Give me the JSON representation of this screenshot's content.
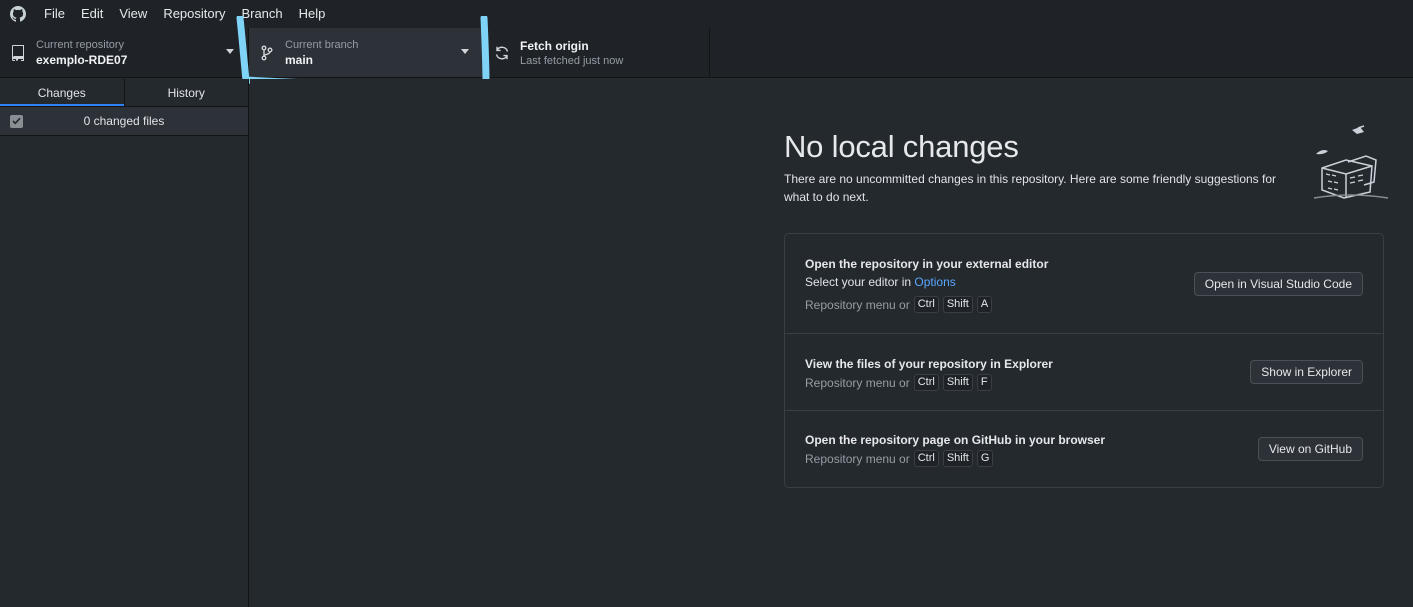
{
  "menu": {
    "items": [
      "File",
      "Edit",
      "View",
      "Repository",
      "Branch",
      "Help"
    ]
  },
  "toolbar": {
    "repository": {
      "label": "Current repository",
      "value": "exemplo-RDE07"
    },
    "branch": {
      "label": "Current branch",
      "value": "main"
    },
    "fetch": {
      "label": "Fetch origin",
      "value": "Last fetched just now"
    }
  },
  "sidebar": {
    "tabs": [
      "Changes",
      "History"
    ],
    "active_tab": "Changes",
    "changes_count": "0 changed files"
  },
  "main": {
    "title": "No local changes",
    "description": "There are no uncommitted changes in this repository. Here are some friendly suggestions for what to do next.",
    "actions": [
      {
        "title": "Open the repository in your external editor",
        "subtitle_prefix": "Select your editor in ",
        "subtitle_link": "Options",
        "shortcut_prefix": "Repository menu or",
        "keys": [
          "Ctrl",
          "Shift",
          "A"
        ],
        "button": "Open in Visual Studio Code"
      },
      {
        "title": "View the files of your repository in Explorer",
        "shortcut_prefix": "Repository menu or",
        "keys": [
          "Ctrl",
          "Shift",
          "F"
        ],
        "button": "Show in Explorer"
      },
      {
        "title": "Open the repository page on GitHub in your browser",
        "shortcut_prefix": "Repository menu or",
        "keys": [
          "Ctrl",
          "Shift",
          "G"
        ],
        "button": "View on GitHub"
      }
    ]
  },
  "colors": {
    "background": "#24292e",
    "toolbar": "#1f2328",
    "accent": "#2f81f7",
    "link": "#58a6ff",
    "highlight_annotation": "#7fd3f7"
  }
}
